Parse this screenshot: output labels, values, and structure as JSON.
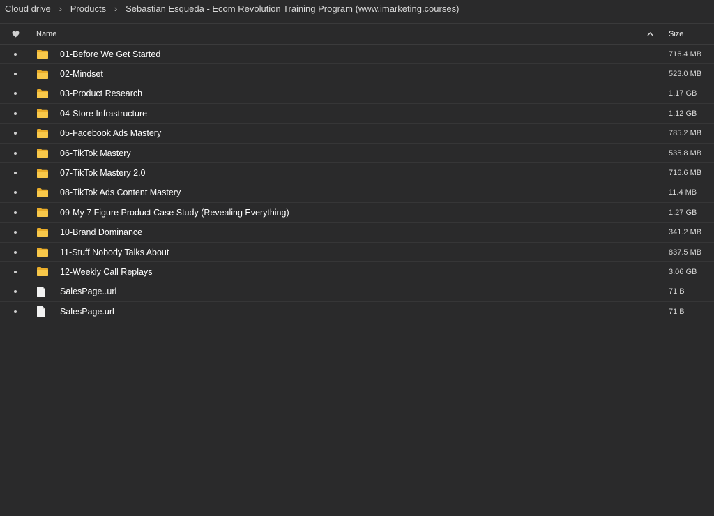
{
  "breadcrumb": {
    "items": [
      "Cloud drive",
      "Products",
      "Sebastian Esqueda - Ecom Revolution Training Program (www.imarketing.courses)"
    ],
    "separator": "›"
  },
  "header": {
    "favorite_icon": "heart-icon",
    "name_label": "Name",
    "sort_icon": "chevron-up-icon",
    "size_label": "Size"
  },
  "colors": {
    "background": "#2a2a2b",
    "folder": "#f6c343",
    "file": "#f2f2f2"
  },
  "items": [
    {
      "type": "folder",
      "name": "01-Before We Get Started",
      "size": "716.4 MB"
    },
    {
      "type": "folder",
      "name": "02-Mindset",
      "size": "523.0 MB"
    },
    {
      "type": "folder",
      "name": "03-Product Research",
      "size": "1.17 GB"
    },
    {
      "type": "folder",
      "name": "04-Store Infrastructure",
      "size": "1.12 GB"
    },
    {
      "type": "folder",
      "name": "05-Facebook Ads Mastery",
      "size": "785.2 MB"
    },
    {
      "type": "folder",
      "name": "06-TikTok Mastery",
      "size": "535.8 MB"
    },
    {
      "type": "folder",
      "name": "07-TikTok Mastery 2.0",
      "size": "716.6 MB"
    },
    {
      "type": "folder",
      "name": "08-TikTok Ads Content Mastery",
      "size": "11.4 MB"
    },
    {
      "type": "folder",
      "name": "09-My 7 Figure Product Case Study (Revealing Everything)",
      "size": "1.27 GB"
    },
    {
      "type": "folder",
      "name": "10-Brand Dominance",
      "size": "341.2 MB"
    },
    {
      "type": "folder",
      "name": "11-Stuff Nobody Talks About",
      "size": "837.5 MB"
    },
    {
      "type": "folder",
      "name": "12-Weekly Call Replays",
      "size": "3.06 GB"
    },
    {
      "type": "file",
      "name": "SalesPage..url",
      "size": "71 B"
    },
    {
      "type": "file",
      "name": "SalesPage.url",
      "size": "71 B"
    }
  ]
}
